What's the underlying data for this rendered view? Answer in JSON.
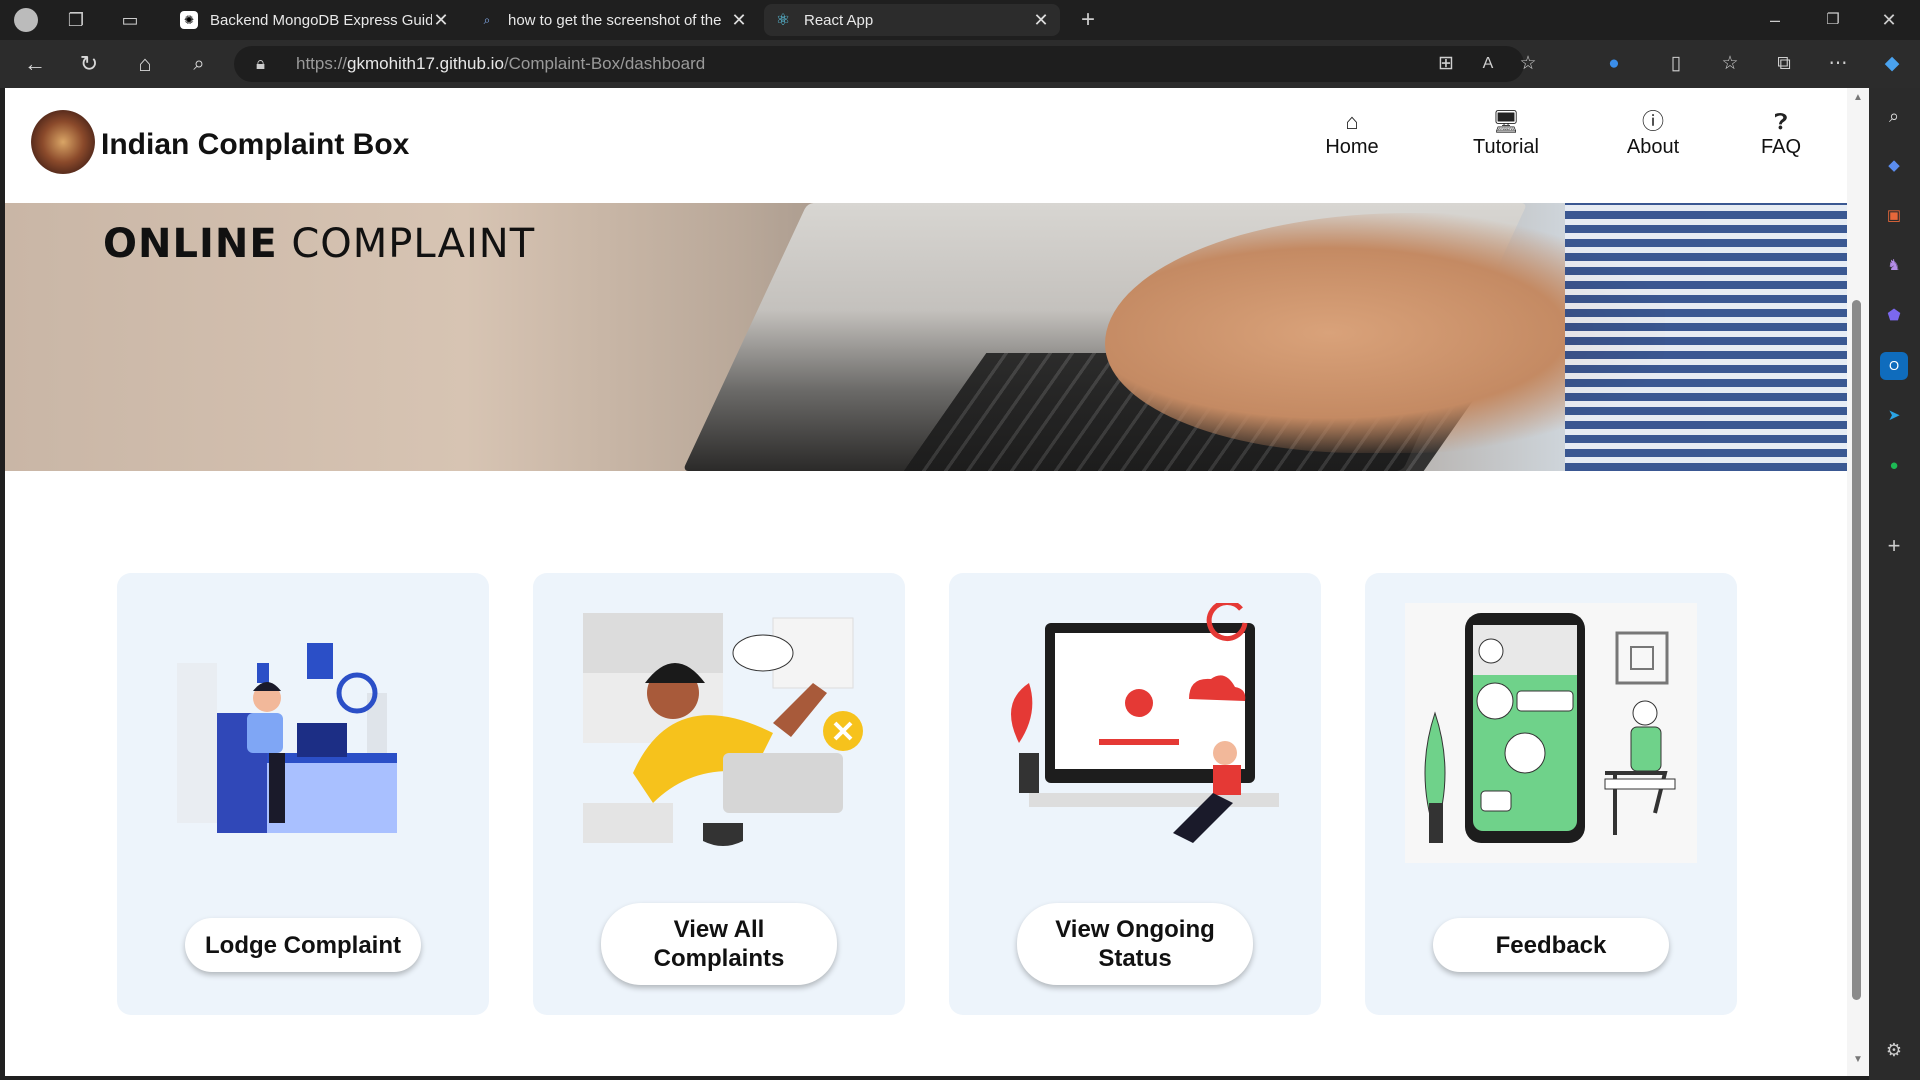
{
  "browser": {
    "tabs": [
      {
        "title": "Backend MongoDB Express Guid",
        "icon": "chatgpt-icon"
      },
      {
        "title": "how to get the screenshot of the",
        "icon": "search-icon"
      },
      {
        "title": "React App",
        "icon": "react-icon",
        "active": true
      }
    ],
    "url_prefix": "https://",
    "url_host": "gkmohith17.github.io",
    "url_path": "/Complaint-Box/dashboard"
  },
  "site": {
    "name": "Indian Complaint Box",
    "nav": [
      {
        "label": "Home",
        "icon": "home-icon"
      },
      {
        "label": "Tutorial",
        "icon": "monitor-icon"
      },
      {
        "label": "About",
        "icon": "info-icon"
      },
      {
        "label": "FAQ",
        "icon": "faq-icon"
      }
    ]
  },
  "banner": {
    "word1": "ONLINE",
    "word2": "COMPLAINT"
  },
  "cards": [
    {
      "label": "Lodge Complaint",
      "illustration": "person-at-desk-illustration"
    },
    {
      "label_line1": "View All",
      "label_line2": "Complaints",
      "illustration": "woman-waving-illustration"
    },
    {
      "label_line1": "View Ongoing",
      "label_line2": "Status",
      "illustration": "status-monitor-illustration"
    },
    {
      "label": "Feedback",
      "illustration": "phone-feedback-illustration"
    }
  ],
  "colors": {
    "card_bg": "#edf4fb",
    "accent_red": "#e53935",
    "accent_blue": "#2b4fc7"
  }
}
